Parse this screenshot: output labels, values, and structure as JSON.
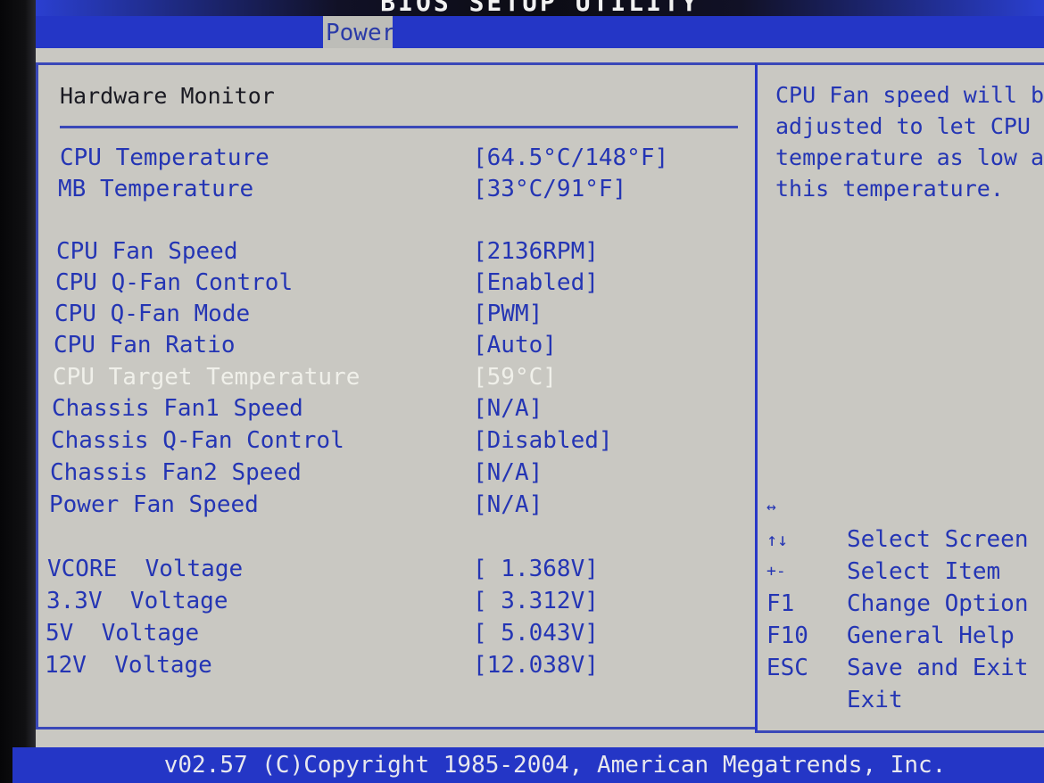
{
  "window": {
    "title": "BIOS SETUP UTILITY"
  },
  "menu": {
    "active_tab": "Power"
  },
  "section": {
    "title": "Hardware Monitor"
  },
  "items": [
    {
      "label": "CPU Temperature",
      "value": "[64.5°C/148°F]"
    },
    {
      "label": "MB Temperature",
      "value": "[33°C/91°F]"
    },
    {
      "label": "CPU Fan Speed",
      "value": "[2136RPM]"
    },
    {
      "label": "CPU Q-Fan Control",
      "value": "[Enabled]"
    },
    {
      "label": "CPU Q-Fan Mode",
      "value": "[PWM]"
    },
    {
      "label": "CPU Fan Ratio",
      "value": "[Auto]"
    },
    {
      "label": "CPU Target Temperature",
      "value": "[59°C]",
      "selected": true
    },
    {
      "label": "Chassis Fan1 Speed",
      "value": "[N/A]"
    },
    {
      "label": "Chassis Q-Fan Control",
      "value": "[Disabled]"
    },
    {
      "label": "Chassis Fan2 Speed",
      "value": "[N/A]"
    },
    {
      "label": "Power Fan Speed",
      "value": "[N/A]"
    },
    {
      "label": "VCORE  Voltage",
      "value": "[ 1.368V]"
    },
    {
      "label": "3.3V  Voltage",
      "value": "[ 3.312V]"
    },
    {
      "label": "5V  Voltage",
      "value": "[ 5.043V]"
    },
    {
      "label": "12V  Voltage",
      "value": "[12.038V]"
    }
  ],
  "help": {
    "text": "CPU Fan speed will be\nadjusted to let CPU\ntemperature as low as\nthis temperature.",
    "keys": [
      {
        "key": "↔",
        "icon": "left-right-arrow-icon",
        "desc": "Select Screen"
      },
      {
        "key": "↑↓",
        "icon": "up-down-arrow-icon",
        "desc": "Select Item"
      },
      {
        "key": "+-",
        "icon": "plus-minus-icon",
        "desc": "Change Option"
      },
      {
        "key": "F1",
        "desc": "General Help"
      },
      {
        "key": "F10",
        "desc": "Save and Exit"
      },
      {
        "key": "ESC",
        "desc": "Exit"
      }
    ]
  },
  "footer": {
    "text": "v02.57 (C)Copyright 1985-2004, American Megatrends, Inc."
  },
  "colors": {
    "background": "#c9c8c2",
    "menu_bar": "#2436c6",
    "item_text": "#2435b4",
    "selected_text": "#f0f0ea",
    "border": "#3a48b8"
  }
}
